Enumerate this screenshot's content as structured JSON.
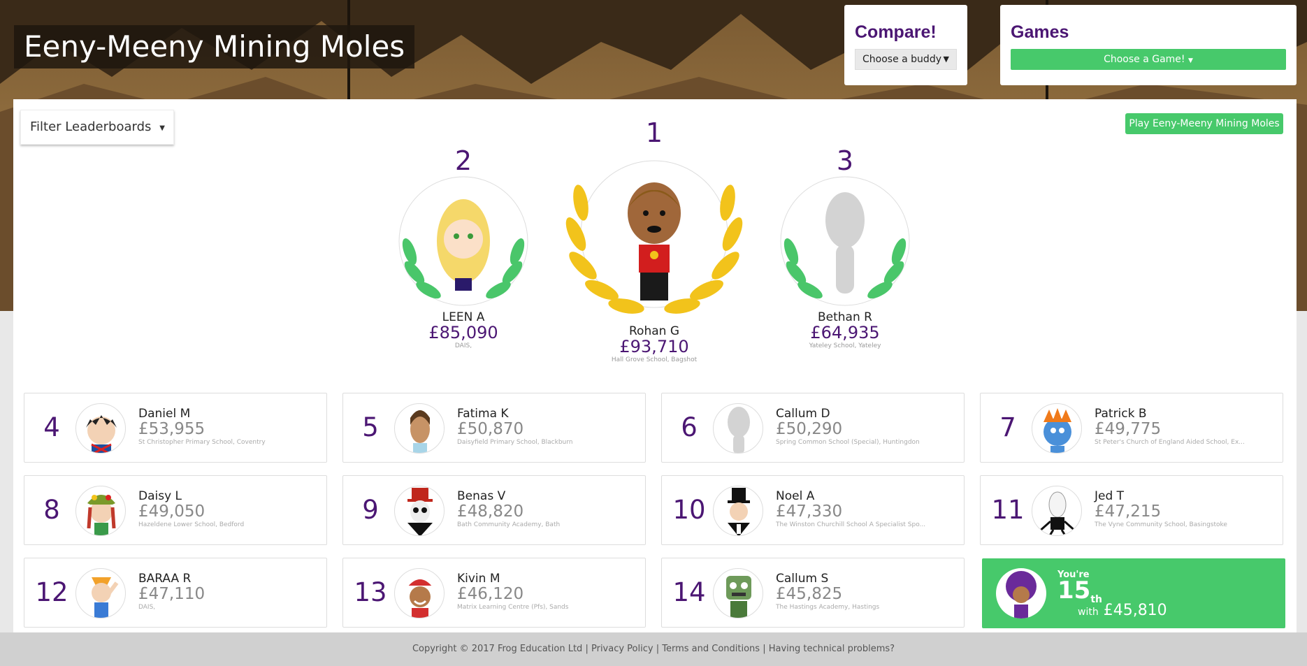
{
  "page_title": "Eeny-Meeny Mining Moles",
  "compare": {
    "title": "Compare!",
    "select_value": "Choose a buddy"
  },
  "games": {
    "title": "Games",
    "button_label": "Choose a Game!"
  },
  "filter": {
    "label": "Filter Leaderboards"
  },
  "play_button": "Play Eeny-Meeny Mining Moles",
  "podium": [
    {
      "rank": "1",
      "name": "Rohan G",
      "score": "£93,710",
      "school": "Hall Grove School, Bagshot"
    },
    {
      "rank": "2",
      "name": "LEEN A",
      "score": "£85,090",
      "school": "DAIS,"
    },
    {
      "rank": "3",
      "name": "Bethan R",
      "score": "£64,935",
      "school": "Yateley School, Yateley"
    }
  ],
  "leaderboard": [
    {
      "rank": "4",
      "name": "Daniel M",
      "score": "£53,955",
      "school": "St Christopher Primary School, Coventry",
      "avatar": "spiky-hair-kid",
      "color": "#222"
    },
    {
      "rank": "5",
      "name": "Fatima K",
      "score": "£50,870",
      "school": "Daisyfield Primary School, Blackburn",
      "avatar": "girl-bun",
      "color": "#7a4a2a"
    },
    {
      "rank": "6",
      "name": "Callum D",
      "score": "£50,290",
      "school": "Spring Common School (Special), Huntingdon",
      "avatar": "placeholder",
      "color": "#d3d3d3"
    },
    {
      "rank": "7",
      "name": "Patrick B",
      "score": "£49,775",
      "school": "St Peter's Church of England Aided School, Ex...",
      "avatar": "blue-creature",
      "color": "#4a90d9"
    },
    {
      "rank": "8",
      "name": "Daisy L",
      "score": "£49,050",
      "school": "Hazeldene Lower School, Bedford",
      "avatar": "flower-hat-girl",
      "color": "#b03a48"
    },
    {
      "rank": "9",
      "name": "Benas V",
      "score": "£48,820",
      "school": "Bath Community Academy, Bath",
      "avatar": "skull-top-hat",
      "color": "#c0271c"
    },
    {
      "rank": "10",
      "name": "Noel A",
      "score": "£47,330",
      "school": "The Winston Churchill School A Specialist Spo...",
      "avatar": "top-hat-gent",
      "color": "#111"
    },
    {
      "rank": "11",
      "name": "Jed T",
      "score": "£47,215",
      "school": "The Vyne Community School, Basingstoke",
      "avatar": "slender-man",
      "color": "#eee"
    },
    {
      "rank": "12",
      "name": "BARAA R",
      "score": "£47,110",
      "school": "DAIS,",
      "avatar": "fox-ears",
      "color": "#3a7bd5"
    },
    {
      "rank": "13",
      "name": "Kivin M",
      "score": "£46,120",
      "school": "Matrix Learning Centre (Pfs), Sands",
      "avatar": "red-cap-boy",
      "color": "#d32f2f"
    },
    {
      "rank": "14",
      "name": "Callum S",
      "score": "£45,825",
      "school": "The Hastings Academy, Hastings",
      "avatar": "green-robot",
      "color": "#6e9a5a"
    }
  ],
  "you": {
    "label": "You're",
    "rank": "15",
    "suffix": "th",
    "with": "with",
    "score": "£45,810"
  },
  "footer": {
    "copyright": "Copyright © 2017 Frog Education Ltd",
    "privacy": "Privacy Policy",
    "terms": "Terms and Conditions",
    "help": "Having technical problems?"
  },
  "colors": {
    "accent": "#47c96b",
    "purple": "#4b1673"
  }
}
